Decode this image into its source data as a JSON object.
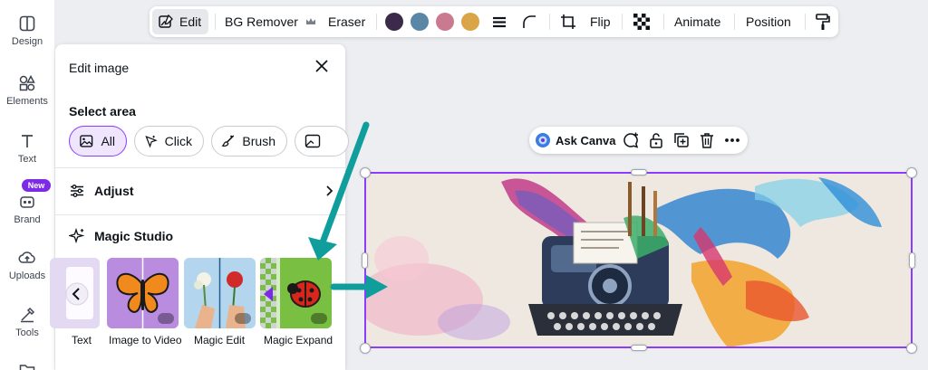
{
  "rail": {
    "items": [
      {
        "label": "Design",
        "icon": "design-icon"
      },
      {
        "label": "Elements",
        "icon": "elements-icon"
      },
      {
        "label": "Text",
        "icon": "text-icon"
      },
      {
        "label": "Brand",
        "icon": "brand-icon",
        "badge": "New"
      },
      {
        "label": "Uploads",
        "icon": "uploads-icon"
      },
      {
        "label": "Tools",
        "icon": "tools-icon"
      }
    ]
  },
  "toolbar": {
    "edit": "Edit",
    "bg_remover": "BG Remover",
    "eraser": "Eraser",
    "flip": "Flip",
    "animate": "Animate",
    "position": "Position",
    "colors": [
      "#3b2a4a",
      "#5b87a6",
      "#c97a8e",
      "#d9a548"
    ]
  },
  "panel": {
    "title": "Edit image",
    "select_area": "Select area",
    "chips": [
      "All",
      "Click",
      "Brush"
    ],
    "adjust": "Adjust",
    "magic_studio": "Magic Studio",
    "tools": [
      "Text",
      "Image to Video",
      "Magic Edit",
      "Magic Expand"
    ]
  },
  "floating": {
    "ask": "Ask Canva"
  },
  "accent": "#8b3dff",
  "arrow_color": "#0f9e9b"
}
